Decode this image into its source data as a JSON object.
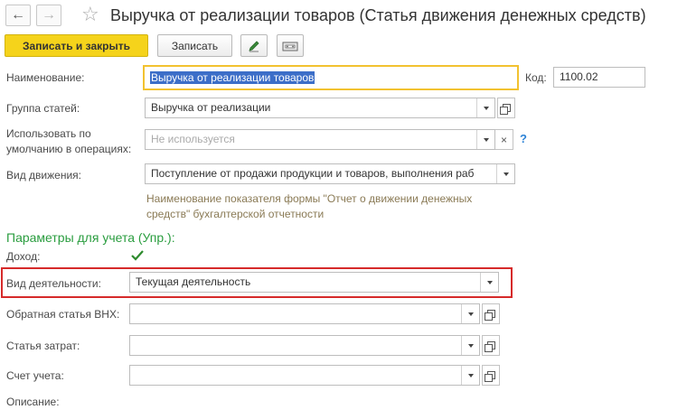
{
  "header": {
    "title": "Выручка от реализации товаров (Статья движения денежных средств)",
    "back_icon": "arrow-left-icon",
    "forward_icon": "arrow-right-icon",
    "favorite_icon": "star-icon"
  },
  "toolbar": {
    "save_close_label": "Записать и закрыть",
    "save_label": "Записать",
    "edit_icon": "pencil-icon",
    "report_icon": "printer-icon"
  },
  "form": {
    "name": {
      "label": "Наименование:",
      "value": "Выручка от реализации товаров"
    },
    "code": {
      "label": "Код:",
      "value": "1100.02"
    },
    "group": {
      "label": "Группа статей:",
      "value": "Выручка от реализации"
    },
    "default_use": {
      "label_line1": "Использовать по",
      "label_line2": "умолчанию в операциях:",
      "placeholder": "Не используется",
      "help": "?"
    },
    "movement": {
      "label": "Вид движения:",
      "value": "Поступление от продажи продукции и товаров, выполнения раб",
      "hint_line1": "Наименование показателя формы \"Отчет о движении денежных",
      "hint_line2": "средств\" бухгалтерской отчетности"
    }
  },
  "params": {
    "title": "Параметры для учета (Упр.):",
    "income": {
      "label": "Доход:",
      "checked": true
    },
    "activity": {
      "label": "Вид деятельности:",
      "value": "Текущая деятельность"
    },
    "reverse": {
      "label": "Обратная статья ВНХ:",
      "value": ""
    },
    "cost": {
      "label": "Статья затрат:",
      "value": ""
    },
    "account": {
      "label": "Счет учета:",
      "value": ""
    },
    "description": {
      "label": "Описание:"
    }
  },
  "colors": {
    "accent_yellow": "#f5d31b",
    "section_green": "#2a9d3f",
    "highlight_red": "#d62a2a",
    "focus_border": "#f2c230"
  }
}
